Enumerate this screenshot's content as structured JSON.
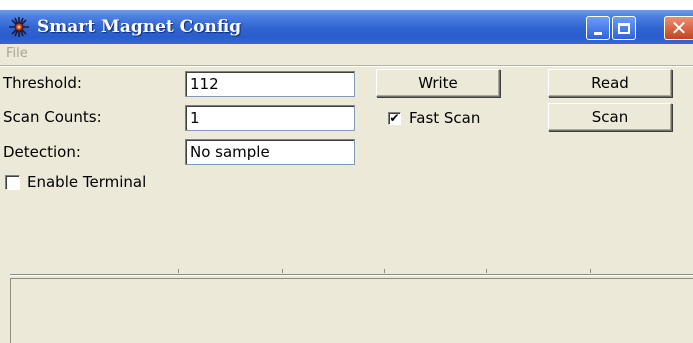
{
  "window": {
    "title": "Smart Magnet Config"
  },
  "menu": {
    "file": "File"
  },
  "form": {
    "threshold": {
      "label": "Threshold:",
      "value": "112"
    },
    "scan_counts": {
      "label": "Scan Counts:",
      "value": "1"
    },
    "detection": {
      "label": "Detection:",
      "value": "No sample"
    }
  },
  "buttons": {
    "write": "Write",
    "read": "Read",
    "scan": "Scan"
  },
  "checkboxes": {
    "fast_scan": {
      "label": "Fast Scan",
      "checked": true
    },
    "enable_terminal": {
      "label": "Enable Terminal",
      "checked": false
    }
  },
  "icons": {
    "app": "magnet-bug-icon",
    "minimize": "minimize-icon",
    "maximize": "maximize-icon",
    "close": "close-icon",
    "check": "checkmark-icon"
  },
  "colors": {
    "titlebar": "#2f63d0",
    "window_bg": "#ece9d8",
    "close_button": "#c6421f",
    "disabled_text": "#a7a597"
  }
}
